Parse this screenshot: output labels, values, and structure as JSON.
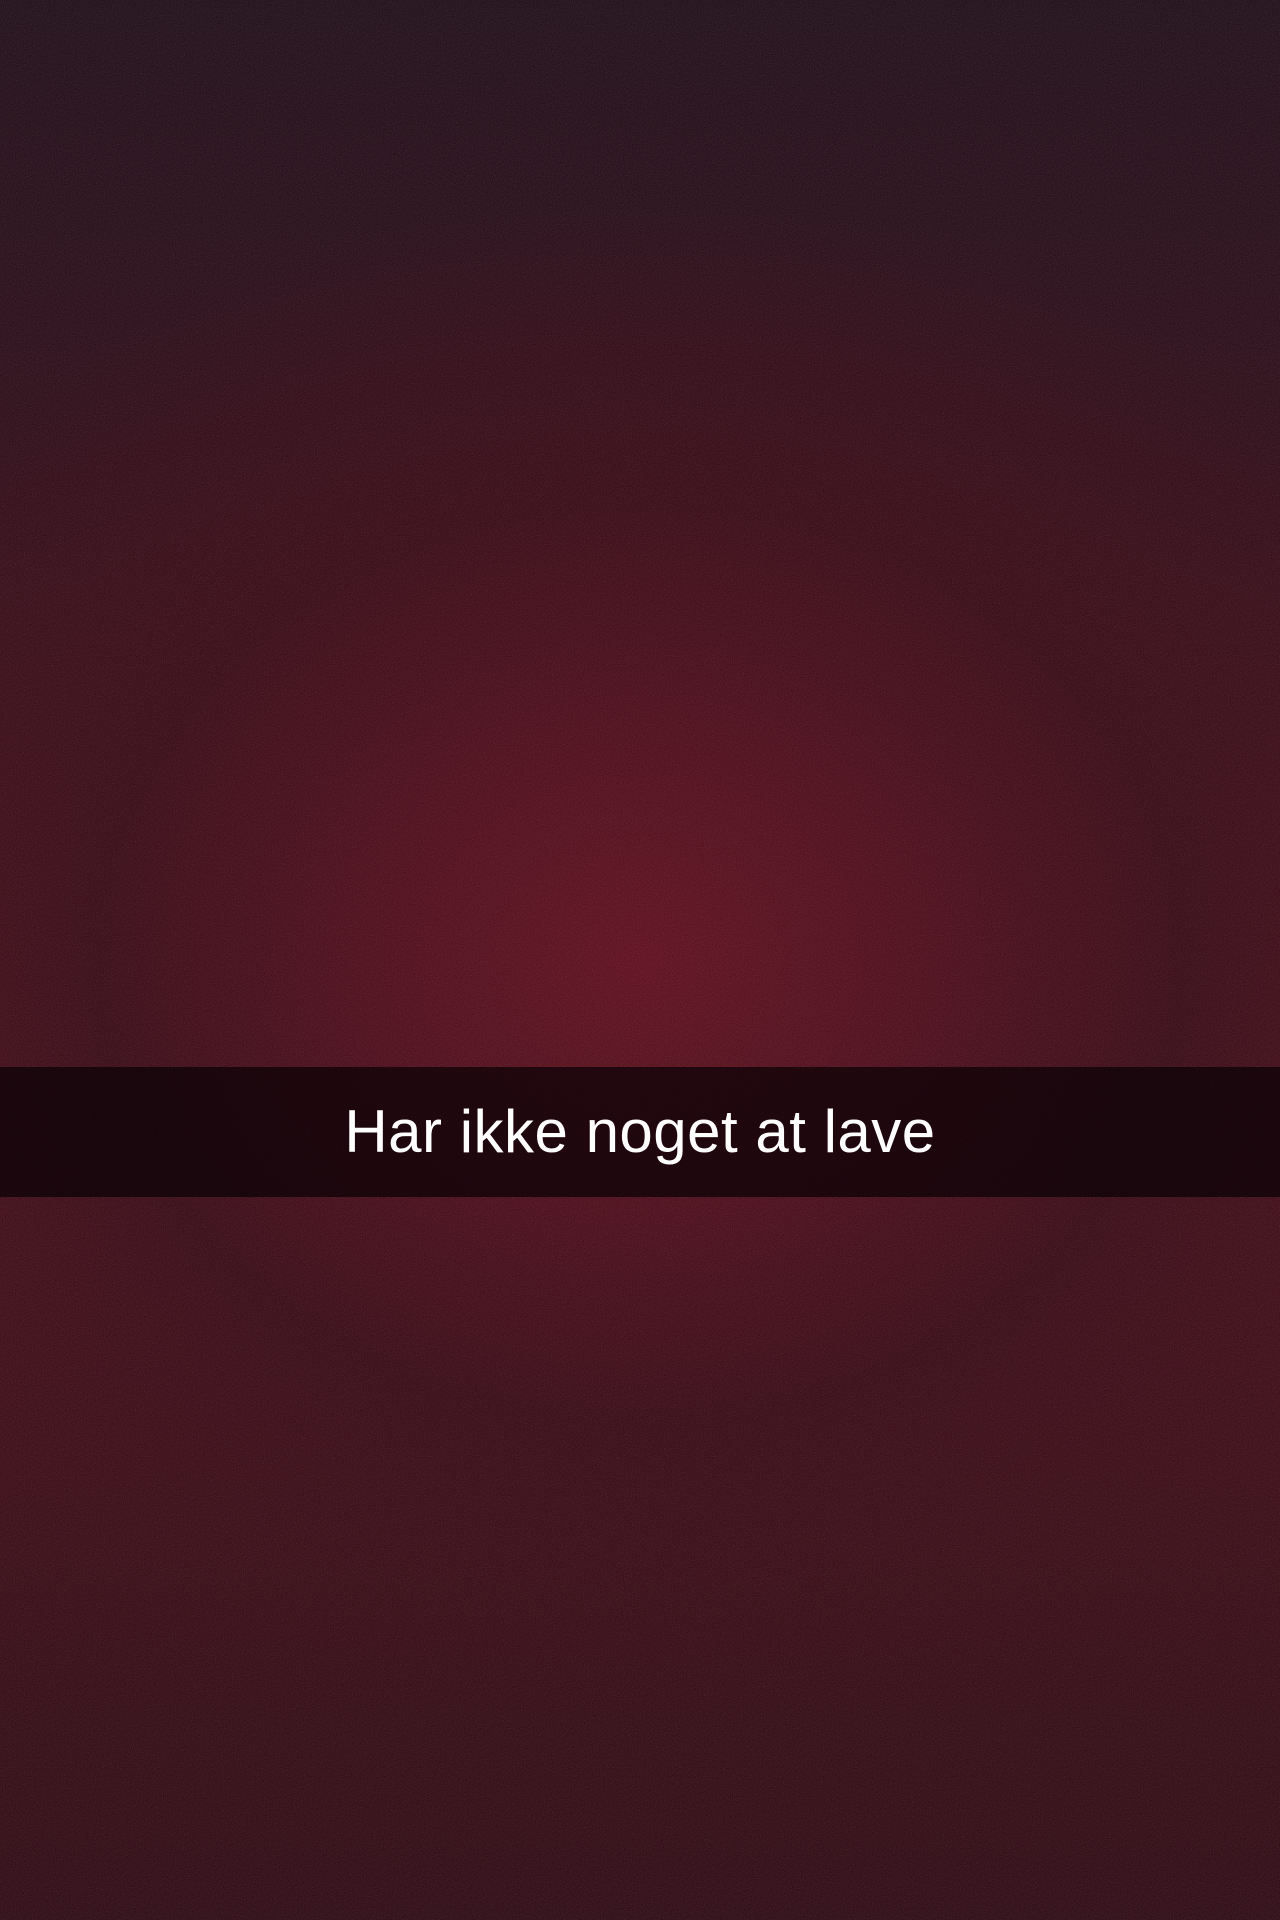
{
  "caption": {
    "text": "Har ikke noget at lave"
  },
  "colors": {
    "background_dark": "#1c0914",
    "background_center": "#5e0a1a",
    "caption_bar": "#0a0205",
    "caption_text": "#ffffff"
  }
}
